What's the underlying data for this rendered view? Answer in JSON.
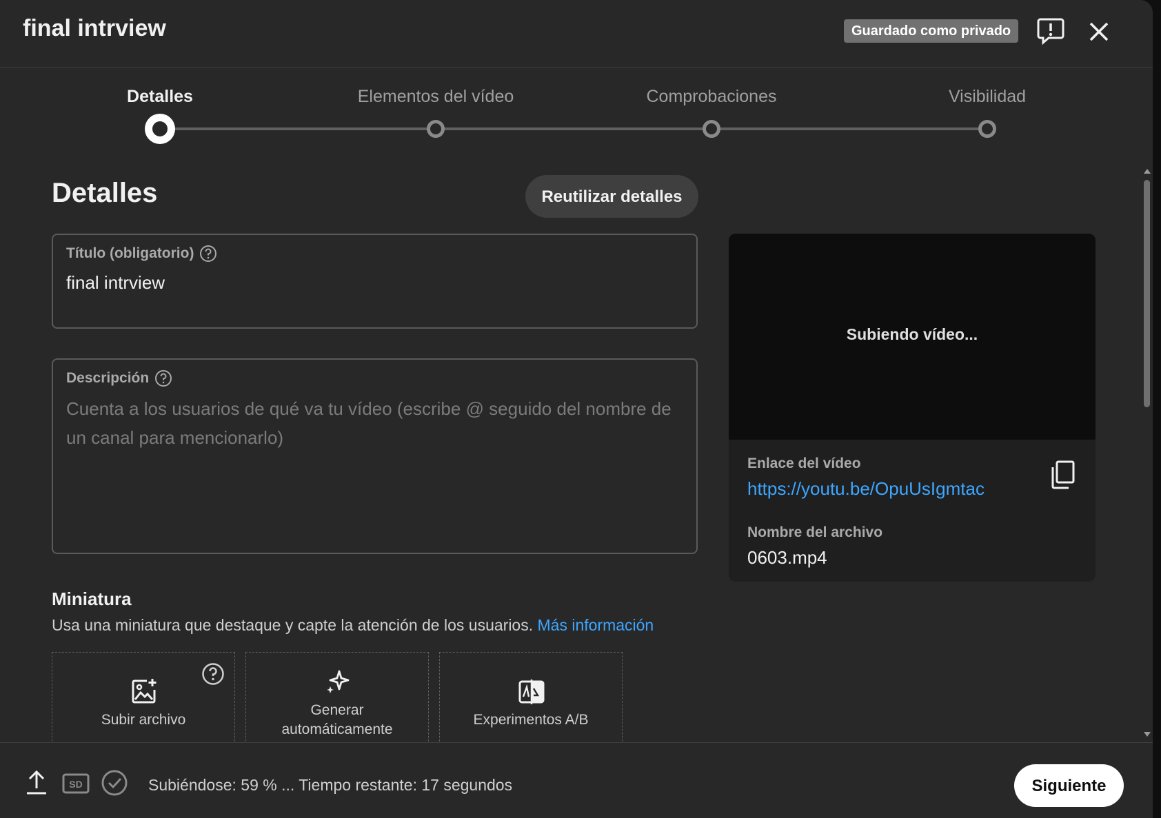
{
  "header": {
    "title": "final intrview",
    "saved_badge": "Guardado como privado"
  },
  "stepper": {
    "steps": [
      {
        "label": "Detalles",
        "active": true
      },
      {
        "label": "Elementos del vídeo",
        "active": false
      },
      {
        "label": "Comprobaciones",
        "active": false
      },
      {
        "label": "Visibilidad",
        "active": false
      }
    ]
  },
  "details": {
    "section_title": "Detalles",
    "reuse_label": "Reutilizar detalles",
    "title_field": {
      "label": "Título (obligatorio)",
      "value": "final intrview"
    },
    "description_field": {
      "label": "Descripción",
      "placeholder": "Cuenta a los usuarios de qué va tu vídeo (escribe @ seguido del nombre de un canal para mencionarlo)"
    }
  },
  "preview": {
    "status": "Subiendo vídeo...",
    "link_label": "Enlace del vídeo",
    "link_value": "https://youtu.be/OpuUsIgmtac",
    "file_label": "Nombre del archivo",
    "file_value": "0603.mp4"
  },
  "thumbnail": {
    "title": "Miniatura",
    "description": "Usa una miniatura que destaque y capte la atención de los usuarios.",
    "more_info": "Más información",
    "options": [
      {
        "label": "Subir archivo",
        "icon": "image-add-icon"
      },
      {
        "label": "Generar",
        "label2": "automáticamente",
        "icon": "sparkle-icon"
      },
      {
        "label": "Experimentos A/B",
        "icon": "ab-test-icon"
      }
    ]
  },
  "footer": {
    "status": "Subiéndose: 59 % ... Tiempo restante: 17 segundos",
    "next_label": "Siguiente",
    "upload_progress_percent": 59
  },
  "colors": {
    "background": "#282828",
    "link": "#3ea6ff",
    "badge": "#717171"
  }
}
